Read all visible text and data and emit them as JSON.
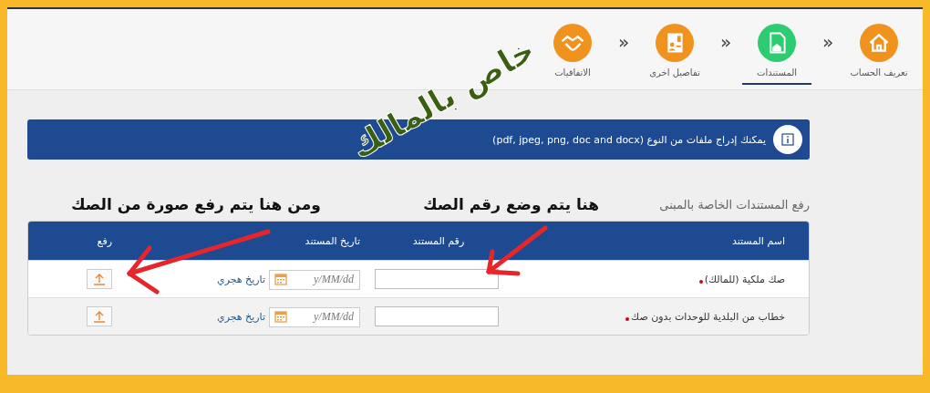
{
  "steps": [
    {
      "label": "تعريف الحساب",
      "kind": "home",
      "selected": false
    },
    {
      "label": "المستندات",
      "kind": "document",
      "selected": true
    },
    {
      "label": "تفاصيل اخرى",
      "kind": "invoice",
      "selected": false
    },
    {
      "label": "الاتفاقيات",
      "kind": "handshake",
      "selected": false
    }
  ],
  "step_separator": "«",
  "info_banner": {
    "text": "يمكنك إدراج ملفات من النوع (pdf, jpeg, png, doc and docx)"
  },
  "section_title": "رفع المستندات الخاصة بالمبنى",
  "table": {
    "columns": [
      "اسم المستند",
      "رقم المستند",
      "تاريخ المستند",
      "رفع"
    ],
    "rows": [
      {
        "name": "صك ملكية (للمالك)",
        "required": true,
        "date_placeholder": "y/MM/dd",
        "date_type": "تاريخ هجري"
      },
      {
        "name": "خطاب من البلدية للوحدات بدون صك",
        "required": true,
        "date_placeholder": "y/MM/dd",
        "date_type": "تاريخ هجري"
      }
    ]
  },
  "annotations": [
    {
      "kind": "stamp",
      "text": "خاص بالمالك"
    },
    {
      "kind": "note",
      "text": "هنا يتم وضع رقم الصك"
    },
    {
      "kind": "note",
      "text": "ومن هنا يتم رفع صورة من الصك"
    }
  ]
}
